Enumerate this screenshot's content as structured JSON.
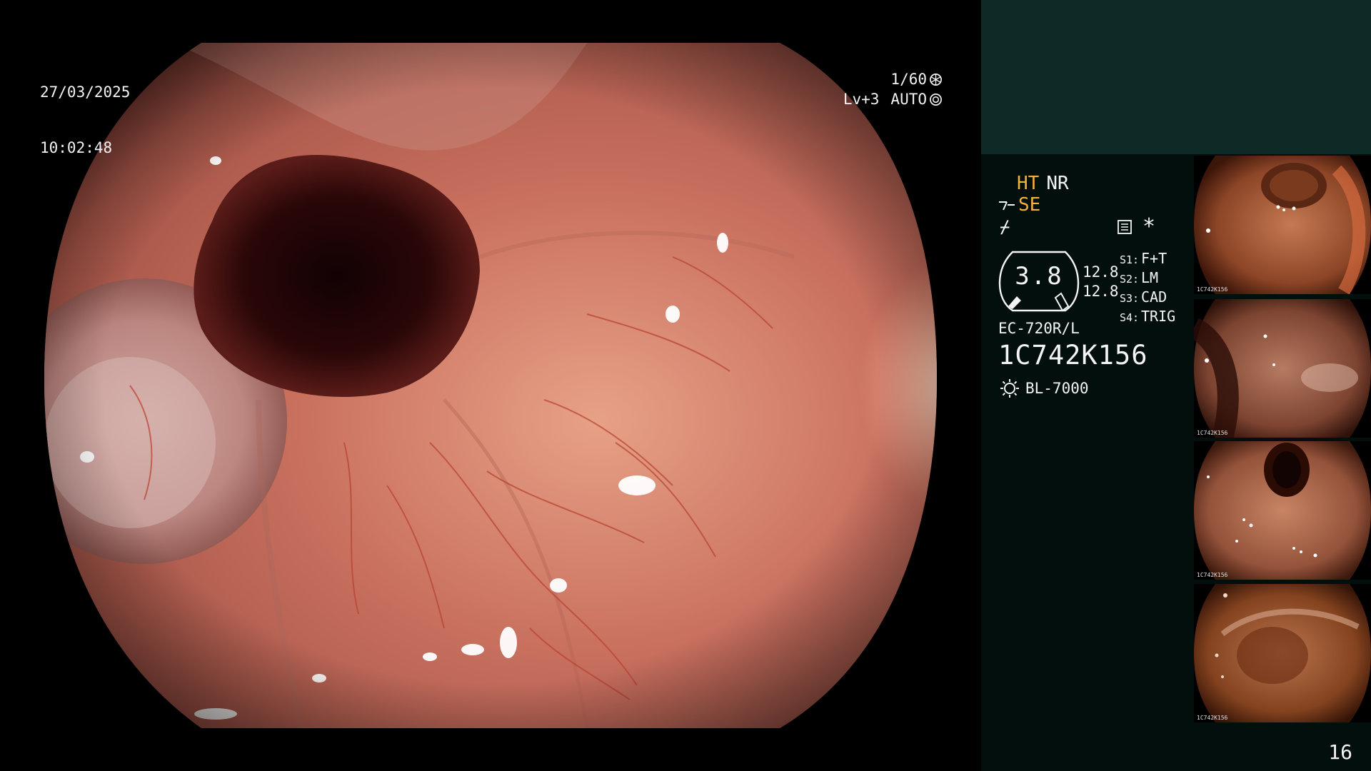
{
  "osd": {
    "date": "27/03/2025",
    "time": "10:02:48",
    "shutter": "1/60",
    "level": "Lv+3",
    "iris_mode": "AUTO"
  },
  "panel": {
    "ht_label": "HT",
    "nr_label": "NR",
    "se_label": "SE",
    "enhancement_symbol": "⌿",
    "gauge_value": "3.8",
    "reading_1": "12.8",
    "reading_2": "12.8",
    "presets": [
      {
        "key": "S1:",
        "value": "F+T"
      },
      {
        "key": "S2:",
        "value": "LM"
      },
      {
        "key": "S3:",
        "value": "CAD"
      },
      {
        "key": "S4:",
        "value": "TRIG"
      }
    ],
    "scope_model": "EC-720R/L",
    "scope_serial": "1C742K156",
    "light_source": "BL-7000",
    "page_number": "16"
  },
  "thumbnails": [
    {
      "label": "1C742K156",
      "index": "15"
    },
    {
      "label": "1C742K156",
      "index": "14"
    },
    {
      "label": "1C742K156",
      "index": "13"
    },
    {
      "label": "1C742K156",
      "index": "12"
    }
  ],
  "colors": {
    "top_panel": "#0e2a27",
    "info_panel": "#030f0d",
    "accent_orange": "#f4b13c",
    "mucosa": "#c9705f"
  },
  "icons": {
    "shutter": "shutter-icon",
    "iris": "iris-icon",
    "light": "light-source-icon",
    "menu": "menu-list-icon",
    "structure": "structure-enhancement-icon"
  }
}
